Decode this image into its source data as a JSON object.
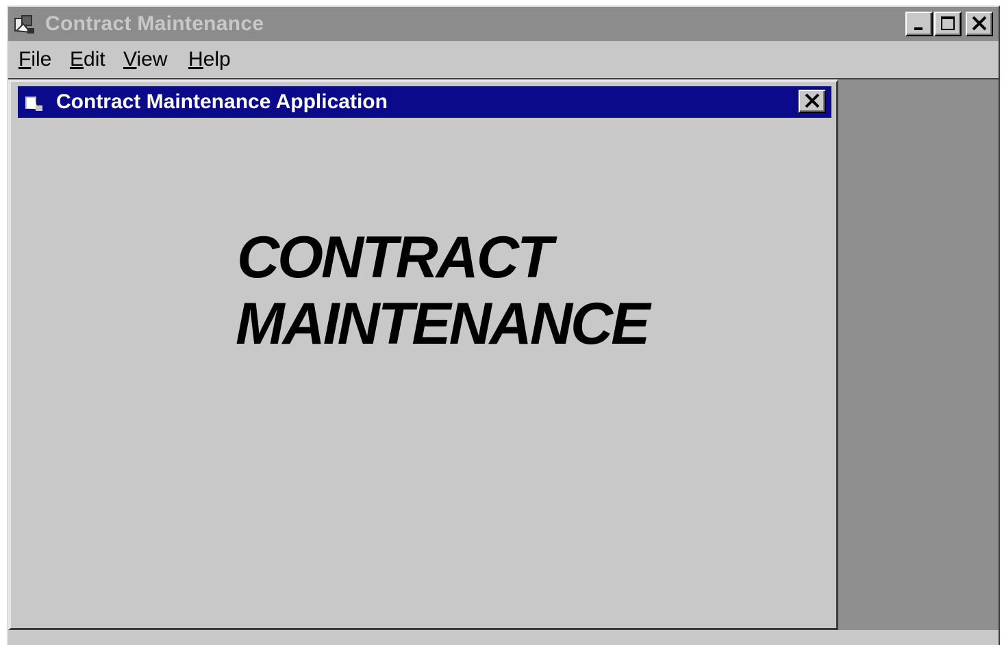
{
  "app": {
    "title": "Contract Maintenance",
    "icon": "contract-app-icon"
  },
  "window_controls": {
    "minimize_icon": "minimize-icon",
    "maximize_icon": "maximize-icon",
    "close_icon": "close-icon"
  },
  "menubar": {
    "items": [
      {
        "accel": "F",
        "rest": "ile"
      },
      {
        "accel": "E",
        "rest": "dit"
      },
      {
        "accel": "V",
        "rest": "iew"
      },
      {
        "accel": "H",
        "rest": "elp"
      }
    ]
  },
  "child_window": {
    "title": "Contract Maintenance Application",
    "icon": "contract-app-icon",
    "close_icon": "close-icon",
    "splash": {
      "line1": "CONTRACT",
      "line2": "MAINTENANCE"
    }
  },
  "colors": {
    "inactive_title": "#8c8c8c",
    "active_title": "#0a0a8a",
    "face": "#c8c8c8",
    "mdi_background": "#8f8f8f"
  }
}
